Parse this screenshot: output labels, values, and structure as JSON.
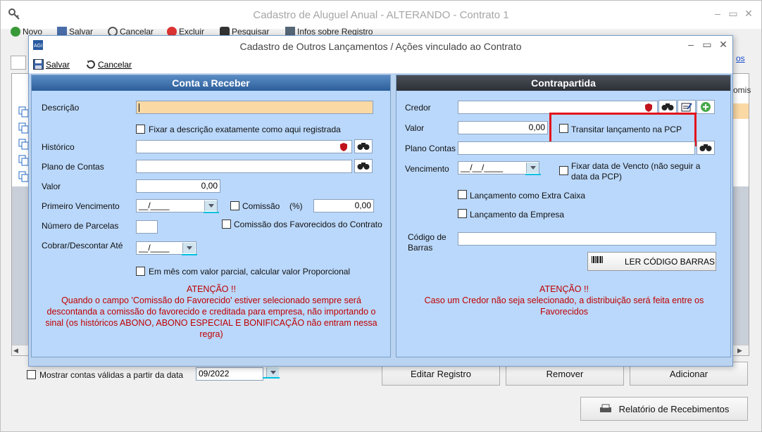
{
  "outer": {
    "title": "Cadastro de Aluguel Anual - ALTERANDO - Contrato 1",
    "toolbar": {
      "novo": "Novo",
      "salvar": "Salvar",
      "cancelar": "Cancelar",
      "excluir": "Excluir",
      "pesquisar": "Pesquisar",
      "infos": "Infos sobre Registro"
    },
    "side_link_fragment": "os",
    "grid_header_fragment": "omis",
    "show_valid": "Mostrar contas válidas a partir da data",
    "show_valid_date": "09/2022",
    "buttons": {
      "editar": "Editar Registro",
      "remover": "Remover",
      "adicionar": "Adicionar",
      "relatorio": "Relatório de Recebimentos"
    }
  },
  "dialog": {
    "title": "Cadastro de Outros Lançamentos / Ações vinculado ao Contrato",
    "toolbar": {
      "salvar": "Salvar",
      "cancelar": "Cancelar"
    },
    "left": {
      "header": "Conta a Receber",
      "descricao_label": "Descrição",
      "descricao_value": "",
      "fixar_desc": "Fixar a descrição exatamente como aqui registrada",
      "historico_label": "Histórico",
      "plano_label": "Plano de Contas",
      "valor_label": "Valor",
      "valor_value": "0,00",
      "primeiro_venc_label": "Primeiro Vencimento",
      "primeiro_venc_value": "__/____",
      "comissao_label": "Comissão",
      "comissao_pct": "(%)",
      "comissao_value": "0,00",
      "parcelas_label": "Número de Parcelas",
      "comissao_fav": "Comissão dos Favorecidos do Contrato",
      "cobrar_label": "Cobrar/Descontar Até",
      "cobrar_value": "__/____",
      "em_mes": "Em mês com valor parcial, calcular valor Proporcional",
      "atencao_title": "ATENÇÃO !!",
      "atencao_text": "Quando o campo 'Comissão do Favorecido' estiver selecionado sempre será descontanda a comissão do favorecido e creditada para empresa, não importando o sinal (os históricos ABONO, ABONO ESPECIAL E BONIFICAÇÃO não entram nessa regra)"
    },
    "right": {
      "header": "Contrapartida",
      "credor_label": "Credor",
      "valor_label": "Valor",
      "valor_value": "0,00",
      "transitar": "Transitar lançamento na PCP",
      "plano_label": "Plano Contas",
      "venc_label": "Vencimento",
      "venc_value": "__/__/____",
      "fixar_data": "Fixar  data de Vencto (não seguir a data da PCP)",
      "extra_caixa": "Lançamento como Extra Caixa",
      "lanc_empresa": "Lançamento da Empresa",
      "codigo_label": "Código de Barras",
      "ler_codigo": "LER CÓDIGO BARRAS",
      "atencao_title": "ATENÇÃO !!",
      "atencao_text": "Caso um Credor não seja selecionado, a distribuição será feita entre os Favorecidos"
    }
  },
  "colors": {
    "highlight": "#e3131b",
    "panel_blue": "#bad8fb",
    "left_header": "#3a6daa",
    "right_header": "#3a3e45",
    "warning": "#c00000"
  }
}
